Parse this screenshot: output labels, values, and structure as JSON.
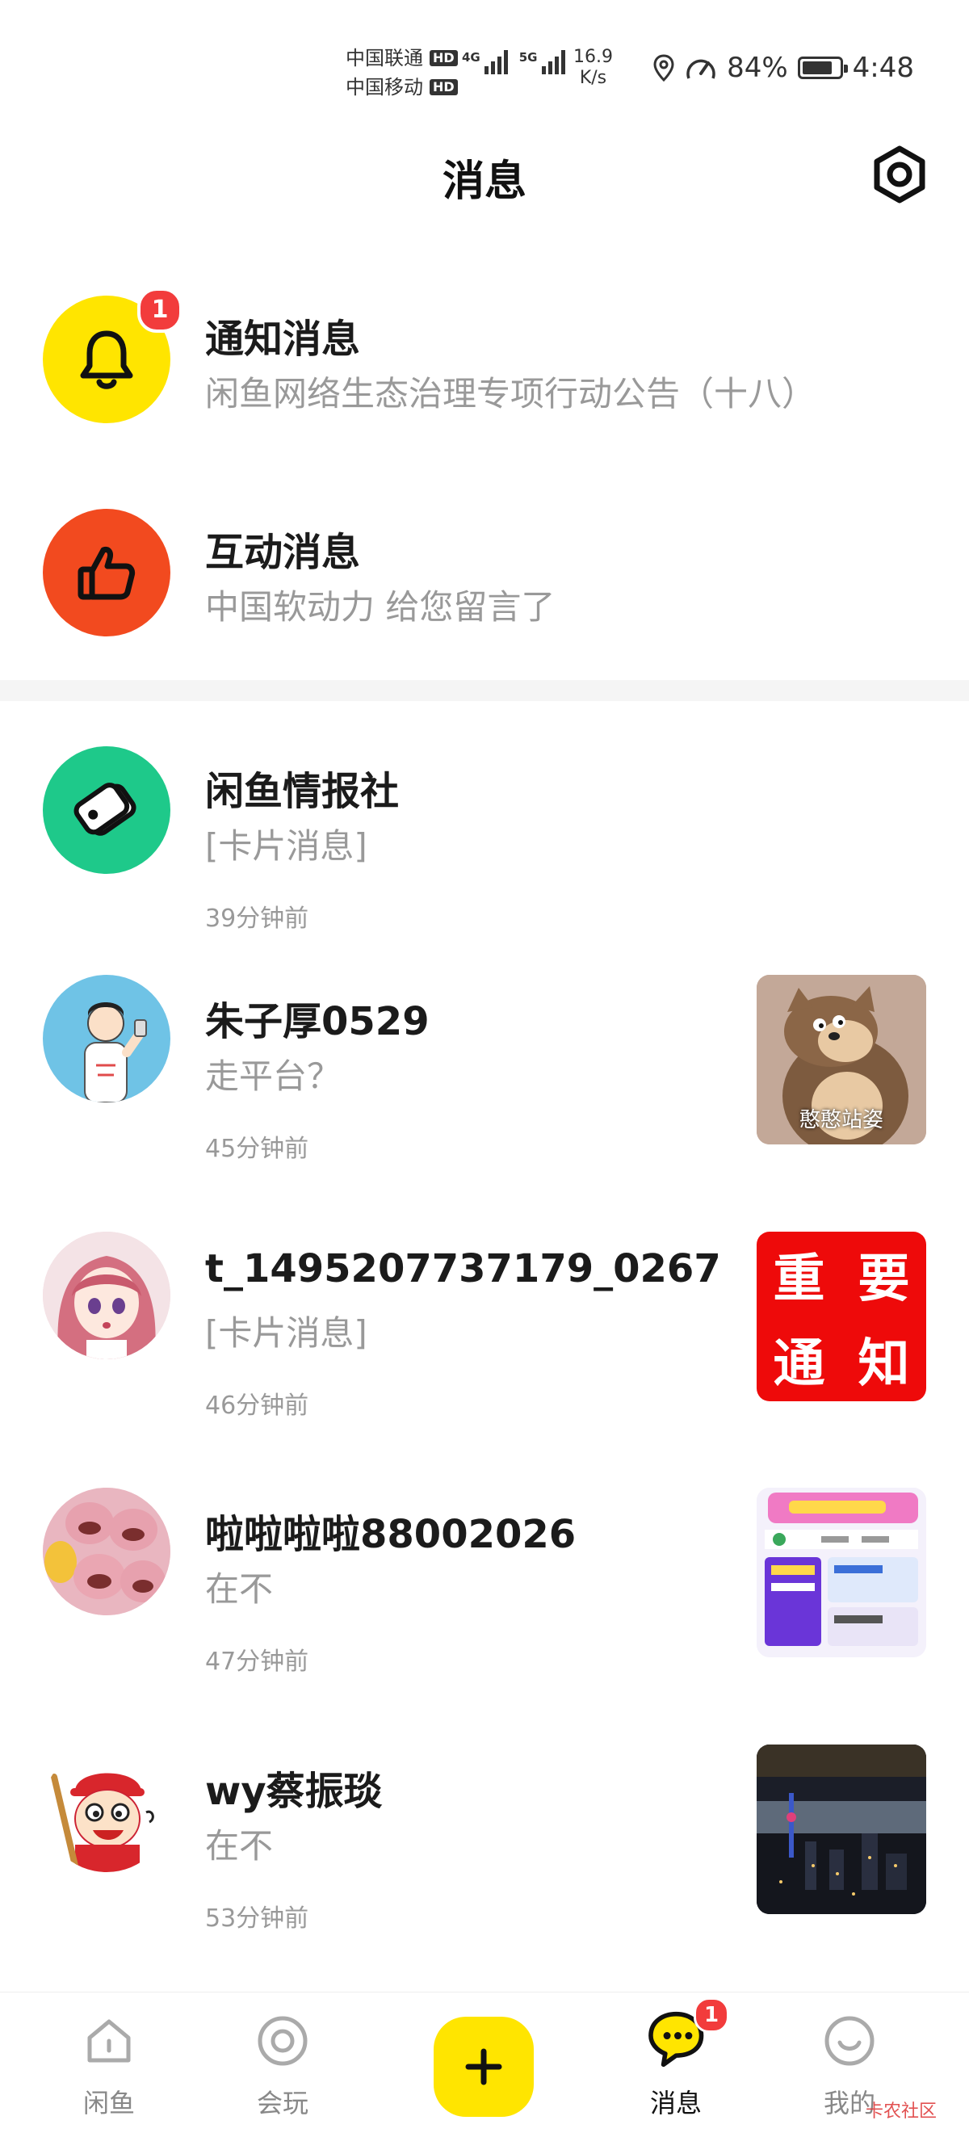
{
  "status_bar": {
    "carrier1": "中国联通",
    "carrier2": "中国移动",
    "hd": "HD",
    "net1": "4G",
    "net2": "5G",
    "speed_value": "16.9",
    "speed_unit": "K/s",
    "battery_percent": "84%",
    "battery_level": 0.84,
    "time": "4:48"
  },
  "header": {
    "title": "消息"
  },
  "system_messages": [
    {
      "title": "通知消息",
      "subtitle": "闲鱼网络生态治理专项行动公告（十八）",
      "badge": "1",
      "icon": "bell-icon",
      "color": "#ffe500"
    },
    {
      "title": "互动消息",
      "subtitle": "中国软动力 给您留言了",
      "icon": "thumbs-up-icon",
      "color": "#f24a1f"
    }
  ],
  "conversations": [
    {
      "name": "闲鱼情报社",
      "preview": "[卡片消息]",
      "time": "39分钟前",
      "icon": "tag-icon",
      "color": "#1ec98a"
    },
    {
      "name": "朱子厚0529",
      "preview": "走平台？",
      "time": "45分钟前",
      "thumb_caption": "憨憨站姿"
    },
    {
      "name": "t_1495207737179_0267",
      "preview": "[卡片消息]",
      "time": "46分钟前",
      "thumb_text": [
        "重",
        "要",
        "通",
        "知"
      ]
    },
    {
      "name": "啦啦啦啦88002026",
      "preview": "在不",
      "time": "47分钟前"
    },
    {
      "name": "wy蔡振琰",
      "preview": "在不",
      "time": "53分钟前"
    }
  ],
  "bottom_nav": [
    {
      "label": "闲鱼",
      "icon": "home-icon"
    },
    {
      "label": "会玩",
      "icon": "circle-play-icon"
    },
    {
      "label": "",
      "icon": "plus-icon"
    },
    {
      "label": "消息",
      "icon": "chat-bubble-icon",
      "badge": "1",
      "active": true
    },
    {
      "label": "我的",
      "icon": "profile-icon"
    }
  ],
  "watermark": "卡农社区"
}
